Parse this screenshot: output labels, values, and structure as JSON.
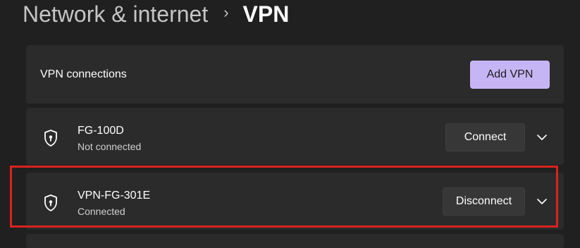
{
  "breadcrumb": {
    "parent": "Network & internet",
    "separator": "›",
    "current": "VPN"
  },
  "vpn_section": {
    "header_label": "VPN connections",
    "add_button_label": "Add VPN"
  },
  "connections": [
    {
      "name": "FG-100D",
      "status": "Not connected",
      "action_label": "Connect",
      "icon": "shield-lock-icon"
    },
    {
      "name": "VPN-FG-301E",
      "status": "Connected",
      "action_label": "Disconnect",
      "icon": "shield-lock-icon",
      "highlighted": true
    }
  ],
  "colors": {
    "accent": "#c6b5f5",
    "background": "#202020",
    "card": "#2b2b2b",
    "highlight_border": "#d9231f"
  }
}
